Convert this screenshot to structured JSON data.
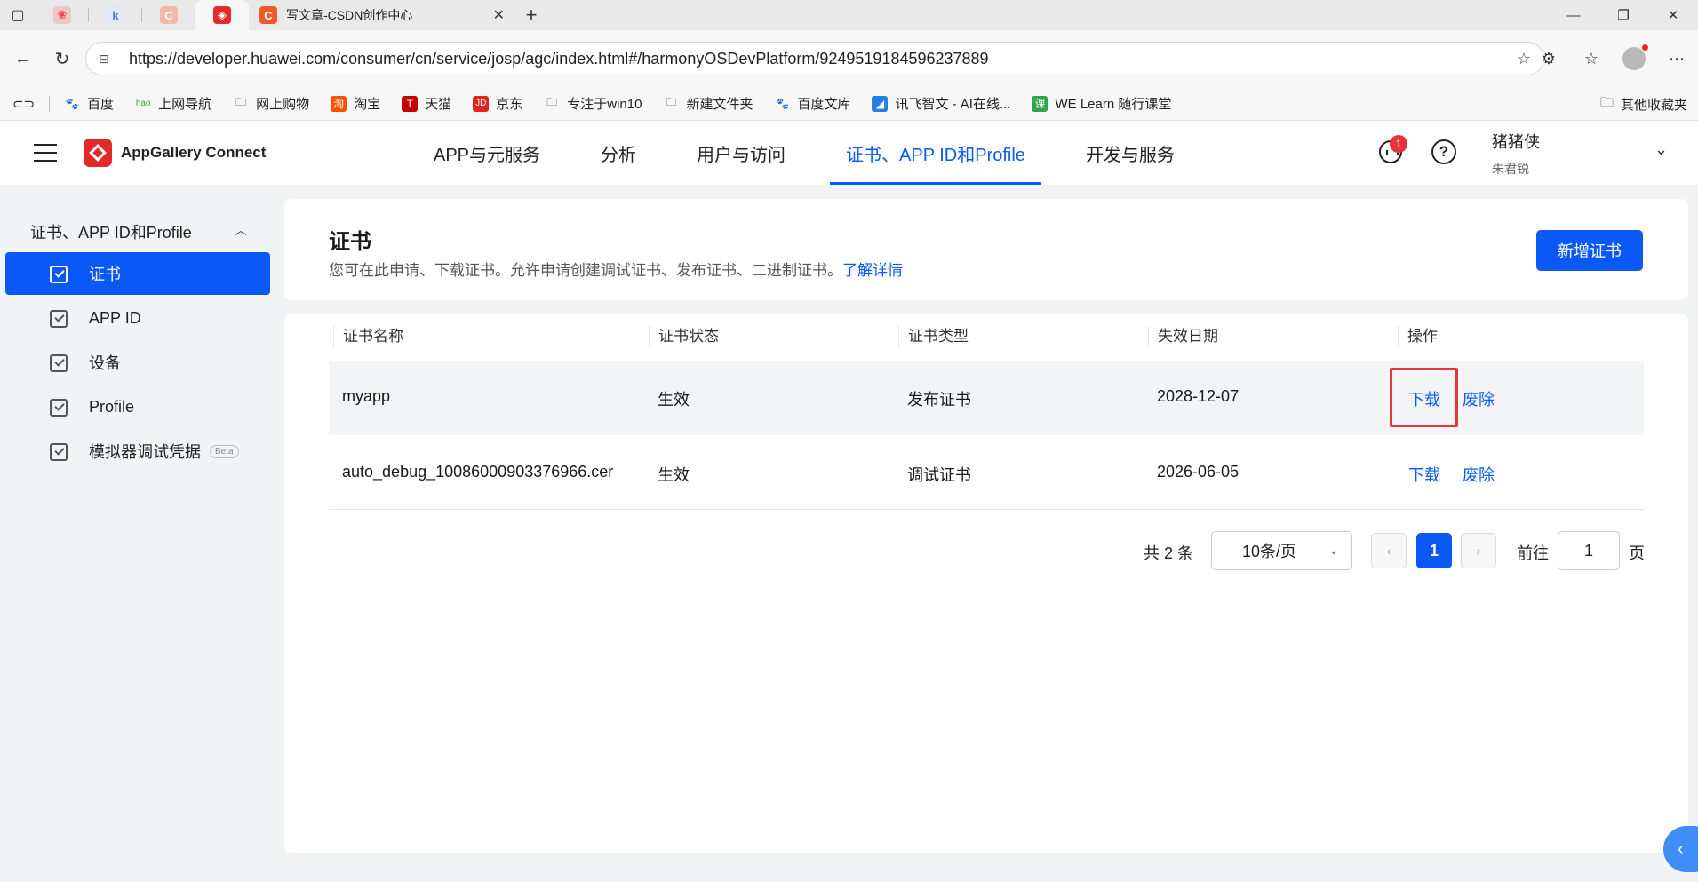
{
  "browser": {
    "active_tab_title": "写文章-CSDN创作中心",
    "tab_k_letter": "k",
    "tab_c_letter": "C",
    "url": "https://developer.huawei.com/consumer/cn/service/josp/agc/index.html#/harmonyOSDevPlatform/9249519184596237889",
    "bookmarks": [
      "百度",
      "上网导航",
      "网上购物",
      "淘宝",
      "天猫",
      "京东",
      "专注于win10",
      "新建文件夹",
      "百度文库",
      "讯飞智文 - AI在线...",
      "WE Learn 随行课堂"
    ],
    "bookmarks_other": "其他收藏夹"
  },
  "app": {
    "brand": "AppGallery Connect",
    "nav": [
      "APP与元服务",
      "分析",
      "用户与访问",
      "证书、APP ID和Profile",
      "开发与服务"
    ],
    "active_nav": 3,
    "notification_count": "1",
    "user_name": "猪猪侠",
    "user_sub": "朱君锐"
  },
  "sidebar": {
    "group_label": "证书、APP ID和Profile",
    "items": [
      {
        "label": "证书"
      },
      {
        "label": "APP ID"
      },
      {
        "label": "设备"
      },
      {
        "label": "Profile"
      },
      {
        "label": "模拟器调试凭据",
        "badge": "Beta"
      }
    ]
  },
  "page": {
    "title": "证书",
    "desc": "您可在此申请、下载证书。允许申请创建调试证书、发布证书、二进制证书。",
    "learn_more": "了解详情",
    "add_button": "新增证书"
  },
  "table": {
    "headers": [
      "证书名称",
      "证书状态",
      "证书类型",
      "失效日期",
      "操作"
    ],
    "rows": [
      {
        "name": "myapp",
        "status": "生效",
        "type": "发布证书",
        "expiry": "2028-12-07",
        "download": "下载",
        "revoke": "废除"
      },
      {
        "name": "auto_debug_10086000903376966.cer",
        "status": "生效",
        "type": "调试证书",
        "expiry": "2026-06-05",
        "download": "下载",
        "revoke": "废除"
      }
    ]
  },
  "pagination": {
    "total": "共 2 条",
    "page_size": "10条/页",
    "current_page": "1",
    "goto_label": "前往",
    "goto_value": "1",
    "page_unit": "页"
  },
  "colors": {
    "accent": "#0a59f7",
    "highlight": "#e8333a",
    "brand": "#e22a2a"
  }
}
